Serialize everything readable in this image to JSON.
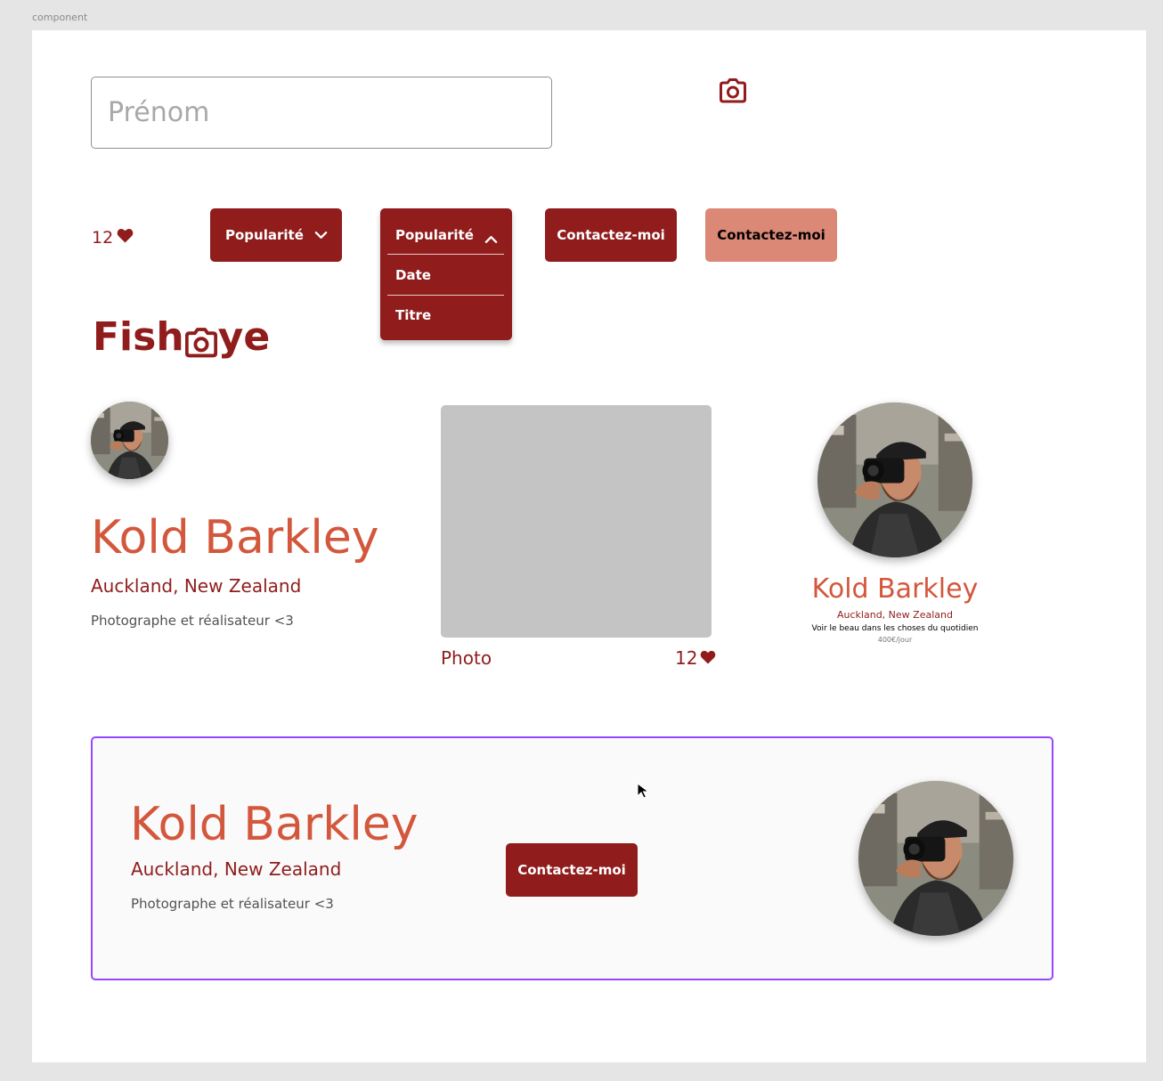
{
  "frame_label": "component",
  "form": {
    "first_name_placeholder": "Prénom"
  },
  "likes_widget": {
    "count": "12"
  },
  "sort": {
    "selected": "Popularité",
    "options": [
      "Popularité",
      "Date",
      "Titre"
    ]
  },
  "contact": {
    "label": "Contactez-moi"
  },
  "logo": {
    "text_before": "Fish",
    "text_after": "ye"
  },
  "photographer": {
    "name": "Kold Barkley",
    "location": "Auckland, New Zealand",
    "tagline": "Photographe et réalisateur <3"
  },
  "media": {
    "title": "Photo",
    "likes": "12"
  },
  "card": {
    "name": "Kold Barkley",
    "location": "Auckland, New Zealand",
    "tagline": "Voir le beau dans les choses du quotidien",
    "price": "400€/jour"
  },
  "banner": {
    "name": "Kold Barkley",
    "location": "Auckland, New Zealand",
    "tagline": "Photographe et réalisateur <3",
    "contact_label": "Contactez-moi"
  },
  "colors": {
    "primary": "#901C1C",
    "accent": "#D3573C",
    "light_button": "#DB8876",
    "selection": "#9747FF",
    "placeholder_grey": "#C4C4C4"
  },
  "icons": {
    "camera": "camera-icon",
    "heart": "heart-icon",
    "chevron_down": "chevron-down-icon",
    "chevron_up": "chevron-up-icon"
  }
}
